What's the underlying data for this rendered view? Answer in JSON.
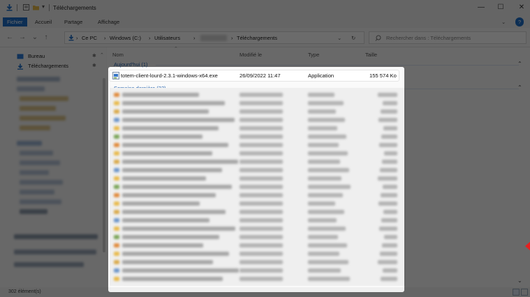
{
  "window": {
    "title": "Téléchargements",
    "controls": {
      "minimize": "—",
      "maximize": "☐",
      "close": "✕"
    }
  },
  "ribbon": {
    "tabs": [
      "Fichier",
      "Accueil",
      "Partage",
      "Affichage"
    ],
    "help": "?"
  },
  "address": {
    "crumbs": [
      "Ce PC",
      "Windows (C:)",
      "Utilisateurs",
      "Téléchargements"
    ],
    "separator": "›",
    "search_placeholder": "Rechercher dans : Téléchargements"
  },
  "navpane": {
    "items": [
      {
        "label": "Bureau",
        "icon": "desktop-icon"
      },
      {
        "label": "Téléchargements",
        "icon": "download-arrow-icon"
      }
    ]
  },
  "columns": {
    "name": "Nom",
    "modified": "Modifié le",
    "type": "Type",
    "size": "Taille"
  },
  "groups": {
    "today": "Aujourd'hui (1)",
    "last_week": "Semaine dernière (33)"
  },
  "file": {
    "name": "totem-client-lourd-2.3.1-windows-x64.exe",
    "modified": "26/09/2022 11:47",
    "type": "Application",
    "size": "155 574 Ko"
  },
  "status": {
    "count": "302 élément(s)"
  },
  "colors": {
    "accent": "#1e6fc8",
    "folder": "#e8b94a",
    "highlight_marker": "#e52020"
  }
}
